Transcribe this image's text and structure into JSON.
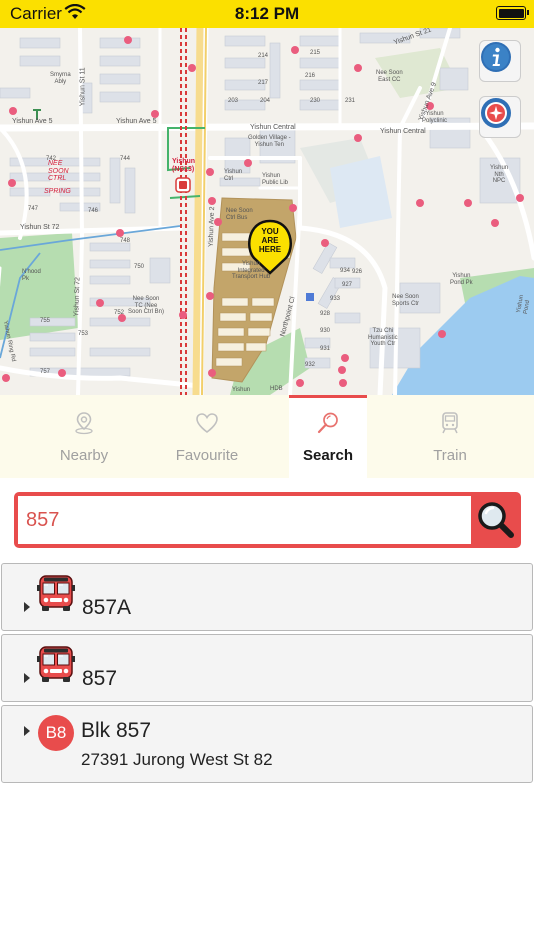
{
  "status_bar": {
    "carrier": "Carrier",
    "time": "8:12 PM"
  },
  "map": {
    "pin_text": [
      "YOU",
      "ARE",
      "HERE"
    ],
    "labels": {
      "nee_soon_ctrl": "NEE\nSOON\nCTRL",
      "spring": "SPRING",
      "yishun_ns13": "Yishun\n(NS13)",
      "yishun_ave5": "Yishun Ave 5",
      "yishun_ave5b": "Yishun Ave 5",
      "yishun_ave2": "Yishun Ave 2",
      "yishun_ave9": "Yishun Ave 9",
      "yishun_central": "Yishun Central",
      "yishun_central2": "Yishun Central",
      "yishun_st11": "Yishun St 11",
      "yishun_st72": "Yishun St 72",
      "yishun_st72b": "Yishun St 72",
      "yishun_st21": "Yishun St 21",
      "northpoint": "Northpoint Cl",
      "nee_soon_ctrl_bus": "Nee Soon\nCtrl Bus",
      "nee_soon_tc": "Nee Soon\nTC (Nee\nSoon Ctrl Bn)",
      "nee_soon_east_cc": "Nee Soon\nEast CC",
      "nee_soon_sports": "Nee Soon\nSports Ctr",
      "golden_village": "Golden Village -\nYishun Ten",
      "yishun_ctrl": "Yishun\nCtrl",
      "yishun_public_lib": "Yishun\nPublic Lib",
      "yishun_integrated": "Yishun\nIntegrated\nTransport Hub",
      "yishun_polyclinic": "Yishun\nPolyclinic",
      "yishun_nth_npc": "Yishun\nNth\nNPC",
      "yishun_pond_pk": "Yishun\nPond Pk",
      "yishun_pond": "Yishun\nPond",
      "tzu_chi": "Tzu Chi\nHumanistic\nYouth Ctr",
      "smyrna": "Smyrna\nAbly",
      "nwood_pk": "N'hood\nPk",
      "yishun_ring_rd": "Yishun Ring Rd",
      "hdb": "HDB",
      "yishun": "Yishun",
      "blk_214": "214",
      "blk_215": "215",
      "blk_216": "216",
      "blk_217": "217",
      "blk_203": "203",
      "blk_204": "204",
      "blk_230": "230",
      "blk_231": "231",
      "blk_742": "742",
      "blk_744": "744",
      "blk_746": "746",
      "blk_747": "747",
      "blk_748": "748",
      "blk_750": "750",
      "blk_752": "752",
      "blk_753": "753",
      "blk_755": "755",
      "blk_757": "757",
      "blk_926": "926",
      "blk_927": "927",
      "blk_928": "928",
      "blk_930": "930",
      "blk_931": "931",
      "blk_932": "932",
      "blk_933": "933",
      "blk_934": "934"
    }
  },
  "tabs": [
    {
      "label": "Nearby",
      "icon": "location-pin-icon",
      "active": false
    },
    {
      "label": "Favourite",
      "icon": "heart-icon",
      "active": false
    },
    {
      "label": "Search",
      "icon": "search-icon",
      "active": true
    },
    {
      "label": "Train",
      "icon": "train-icon",
      "active": false
    }
  ],
  "search": {
    "value": "857",
    "placeholder": ""
  },
  "results": [
    {
      "type": "bus",
      "label": "857A",
      "icon": "bus-icon"
    },
    {
      "type": "bus",
      "label": "857",
      "icon": "bus-icon"
    },
    {
      "type": "stop",
      "badge": "B8",
      "name": "Blk 857",
      "address": "27391 Jurong West St 82"
    }
  ],
  "colors": {
    "status_bar": "#fbe000",
    "accent": "#e84c4c",
    "tab_bg": "#fdfbeb",
    "map_bg": "#f3f1ec",
    "park": "#b6ddb0",
    "water": "#9ccbf0",
    "hub": "#c3a56a"
  }
}
